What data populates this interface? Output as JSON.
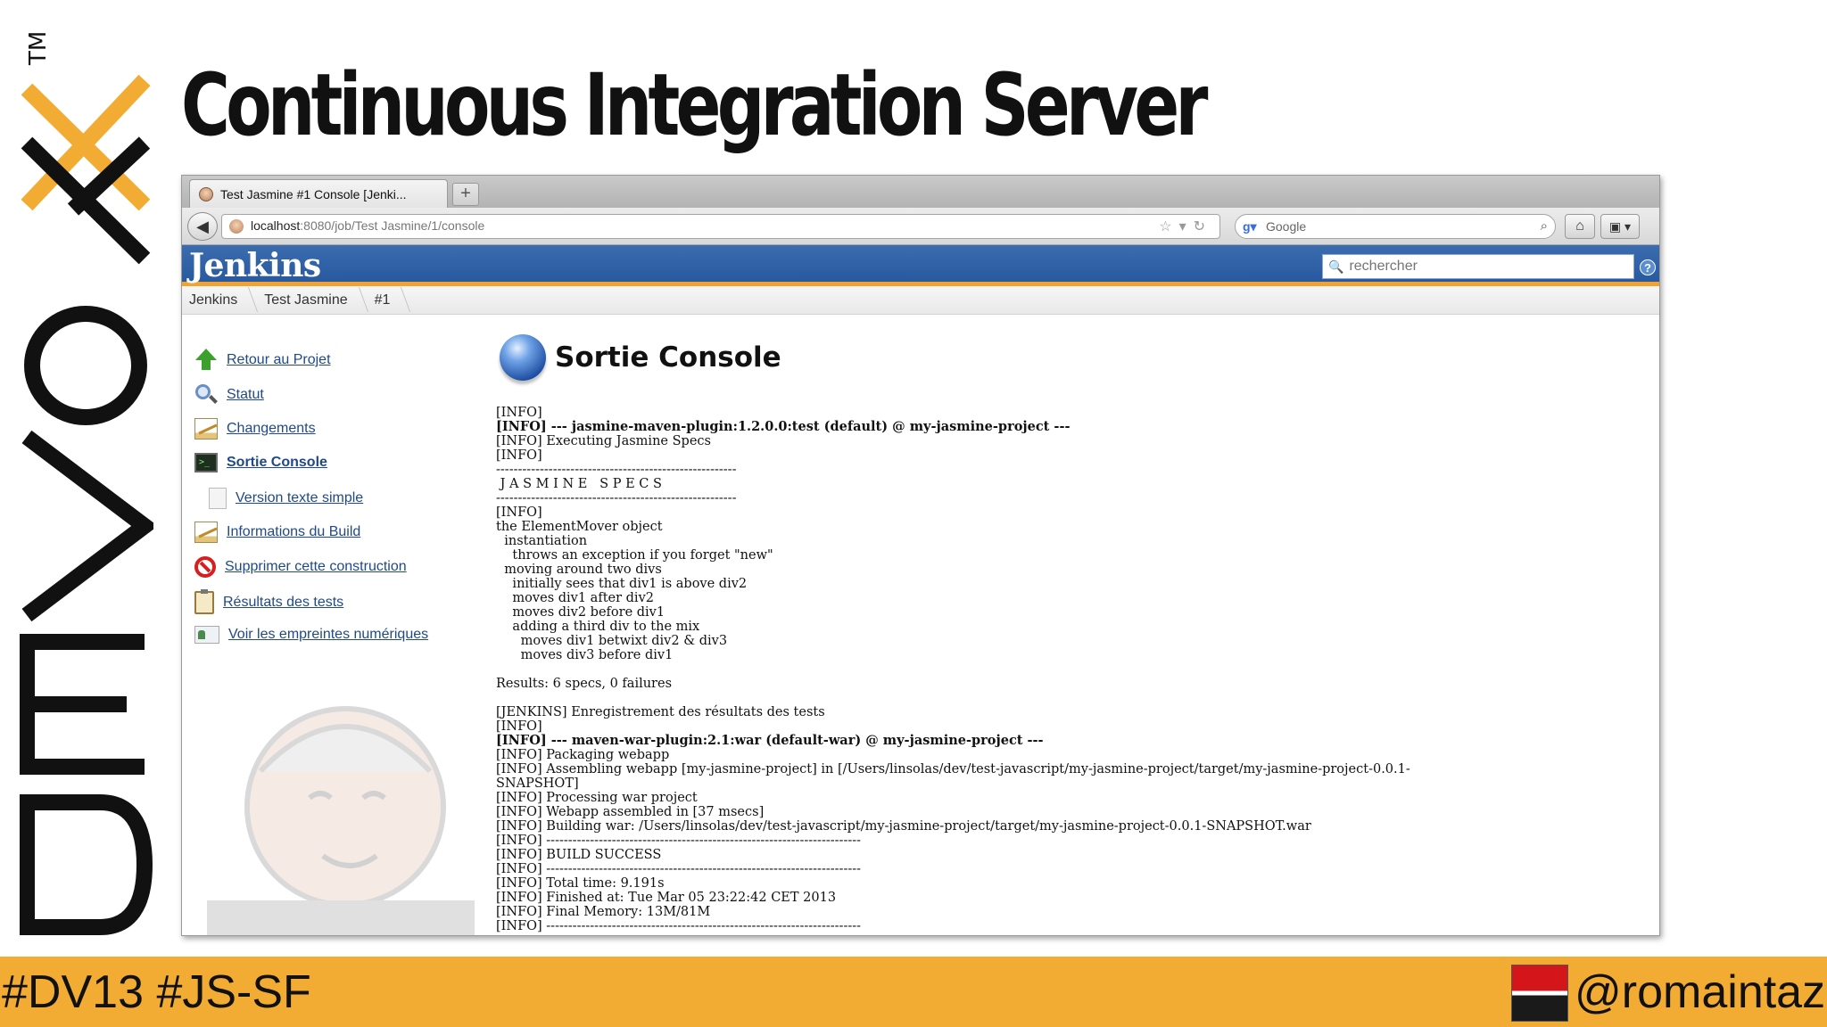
{
  "slide": {
    "title": "Continuous Integration Server",
    "brand": "DEVOXX",
    "trademark": "TM",
    "hashtags": "#DV13 #JS-SF",
    "twitter_handle": "@romaintaz",
    "accent_color": "#f3ac33"
  },
  "browser": {
    "tab_title": "Test Jasmine #1 Console [Jenki...",
    "new_tab_label": "+",
    "url_host": "localhost",
    "url_path": ":8080/job/Test Jasmine/1/console",
    "search_engine": "Google"
  },
  "jenkins": {
    "logo": "Jenkins",
    "search_placeholder": "rechercher",
    "help_label": "?",
    "header_color": "#3465a4",
    "breadcrumb": [
      "Jenkins",
      "Test Jasmine",
      "#1"
    ],
    "side_tasks": [
      {
        "label": "Retour au Projet",
        "icon": "up-arrow-icon"
      },
      {
        "label": "Statut",
        "icon": "magnifier-icon"
      },
      {
        "label": "Changements",
        "icon": "notepad-icon"
      },
      {
        "label": "Sortie Console",
        "icon": "terminal-icon"
      },
      {
        "label": "Version texte simple",
        "icon": "document-icon"
      },
      {
        "label": "Informations du Build",
        "icon": "notepad-icon"
      },
      {
        "label": "Supprimer cette construction",
        "icon": "no-entry-icon"
      },
      {
        "label": "Résultats des tests",
        "icon": "clipboard-icon"
      },
      {
        "label": "Voir les empreintes numériques",
        "icon": "fingerprint-card-icon"
      }
    ],
    "page_title": "Sortie Console",
    "console_lines": [
      {
        "text": "[INFO]",
        "bold": false
      },
      {
        "text": "[INFO] --- jasmine-maven-plugin:1.2.0.0:test (default) @ my-jasmine-project ---",
        "bold": true
      },
      {
        "text": "[INFO] Executing Jasmine Specs",
        "bold": false
      },
      {
        "text": "[INFO]",
        "bold": false
      },
      {
        "text": "-------------------------------------------------------",
        "bold": false
      },
      {
        "text": " J A S M I N E   S P E C S",
        "bold": false
      },
      {
        "text": "-------------------------------------------------------",
        "bold": false
      },
      {
        "text": "[INFO]",
        "bold": false
      },
      {
        "text": "the ElementMover object",
        "bold": false
      },
      {
        "text": "  instantiation",
        "bold": false
      },
      {
        "text": "    throws an exception if you forget \"new\"",
        "bold": false
      },
      {
        "text": "  moving around two divs",
        "bold": false
      },
      {
        "text": "    initially sees that div1 is above div2",
        "bold": false
      },
      {
        "text": "    moves div1 after div2",
        "bold": false
      },
      {
        "text": "    moves div2 before div1",
        "bold": false
      },
      {
        "text": "    adding a third div to the mix",
        "bold": false
      },
      {
        "text": "      moves div1 betwixt div2 & div3",
        "bold": false
      },
      {
        "text": "      moves div3 before div1",
        "bold": false
      },
      {
        "text": "",
        "bold": false
      },
      {
        "text": "Results: 6 specs, 0 failures",
        "bold": false
      },
      {
        "text": "",
        "bold": false
      },
      {
        "text": "[JENKINS] Enregistrement des résultats des tests",
        "bold": false
      },
      {
        "text": "[INFO]",
        "bold": false
      },
      {
        "text": "[INFO] --- maven-war-plugin:2.1:war (default-war) @ my-jasmine-project ---",
        "bold": true
      },
      {
        "text": "[INFO] Packaging webapp",
        "bold": false
      },
      {
        "text": "[INFO] Assembling webapp [my-jasmine-project] in [/Users/linsolas/dev/test-javascript/my-jasmine-project/target/my-jasmine-project-0.0.1-",
        "bold": false
      },
      {
        "text": "SNAPSHOT]",
        "bold": false
      },
      {
        "text": "[INFO] Processing war project",
        "bold": false
      },
      {
        "text": "[INFO] Webapp assembled in [37 msecs]",
        "bold": false
      },
      {
        "text": "[INFO] Building war: /Users/linsolas/dev/test-javascript/my-jasmine-project/target/my-jasmine-project-0.0.1-SNAPSHOT.war",
        "bold": false
      },
      {
        "text": "[INFO] ------------------------------------------------------------------------",
        "bold": false
      },
      {
        "text": "[INFO] BUILD SUCCESS",
        "bold": false
      },
      {
        "text": "[INFO] ------------------------------------------------------------------------",
        "bold": false
      },
      {
        "text": "[INFO] Total time: 9.191s",
        "bold": false
      },
      {
        "text": "[INFO] Finished at: Tue Mar 05 23:22:42 CET 2013",
        "bold": false
      },
      {
        "text": "[INFO] Final Memory: 13M/81M",
        "bold": false
      },
      {
        "text": "[INFO] ------------------------------------------------------------------------",
        "bold": false
      }
    ]
  }
}
